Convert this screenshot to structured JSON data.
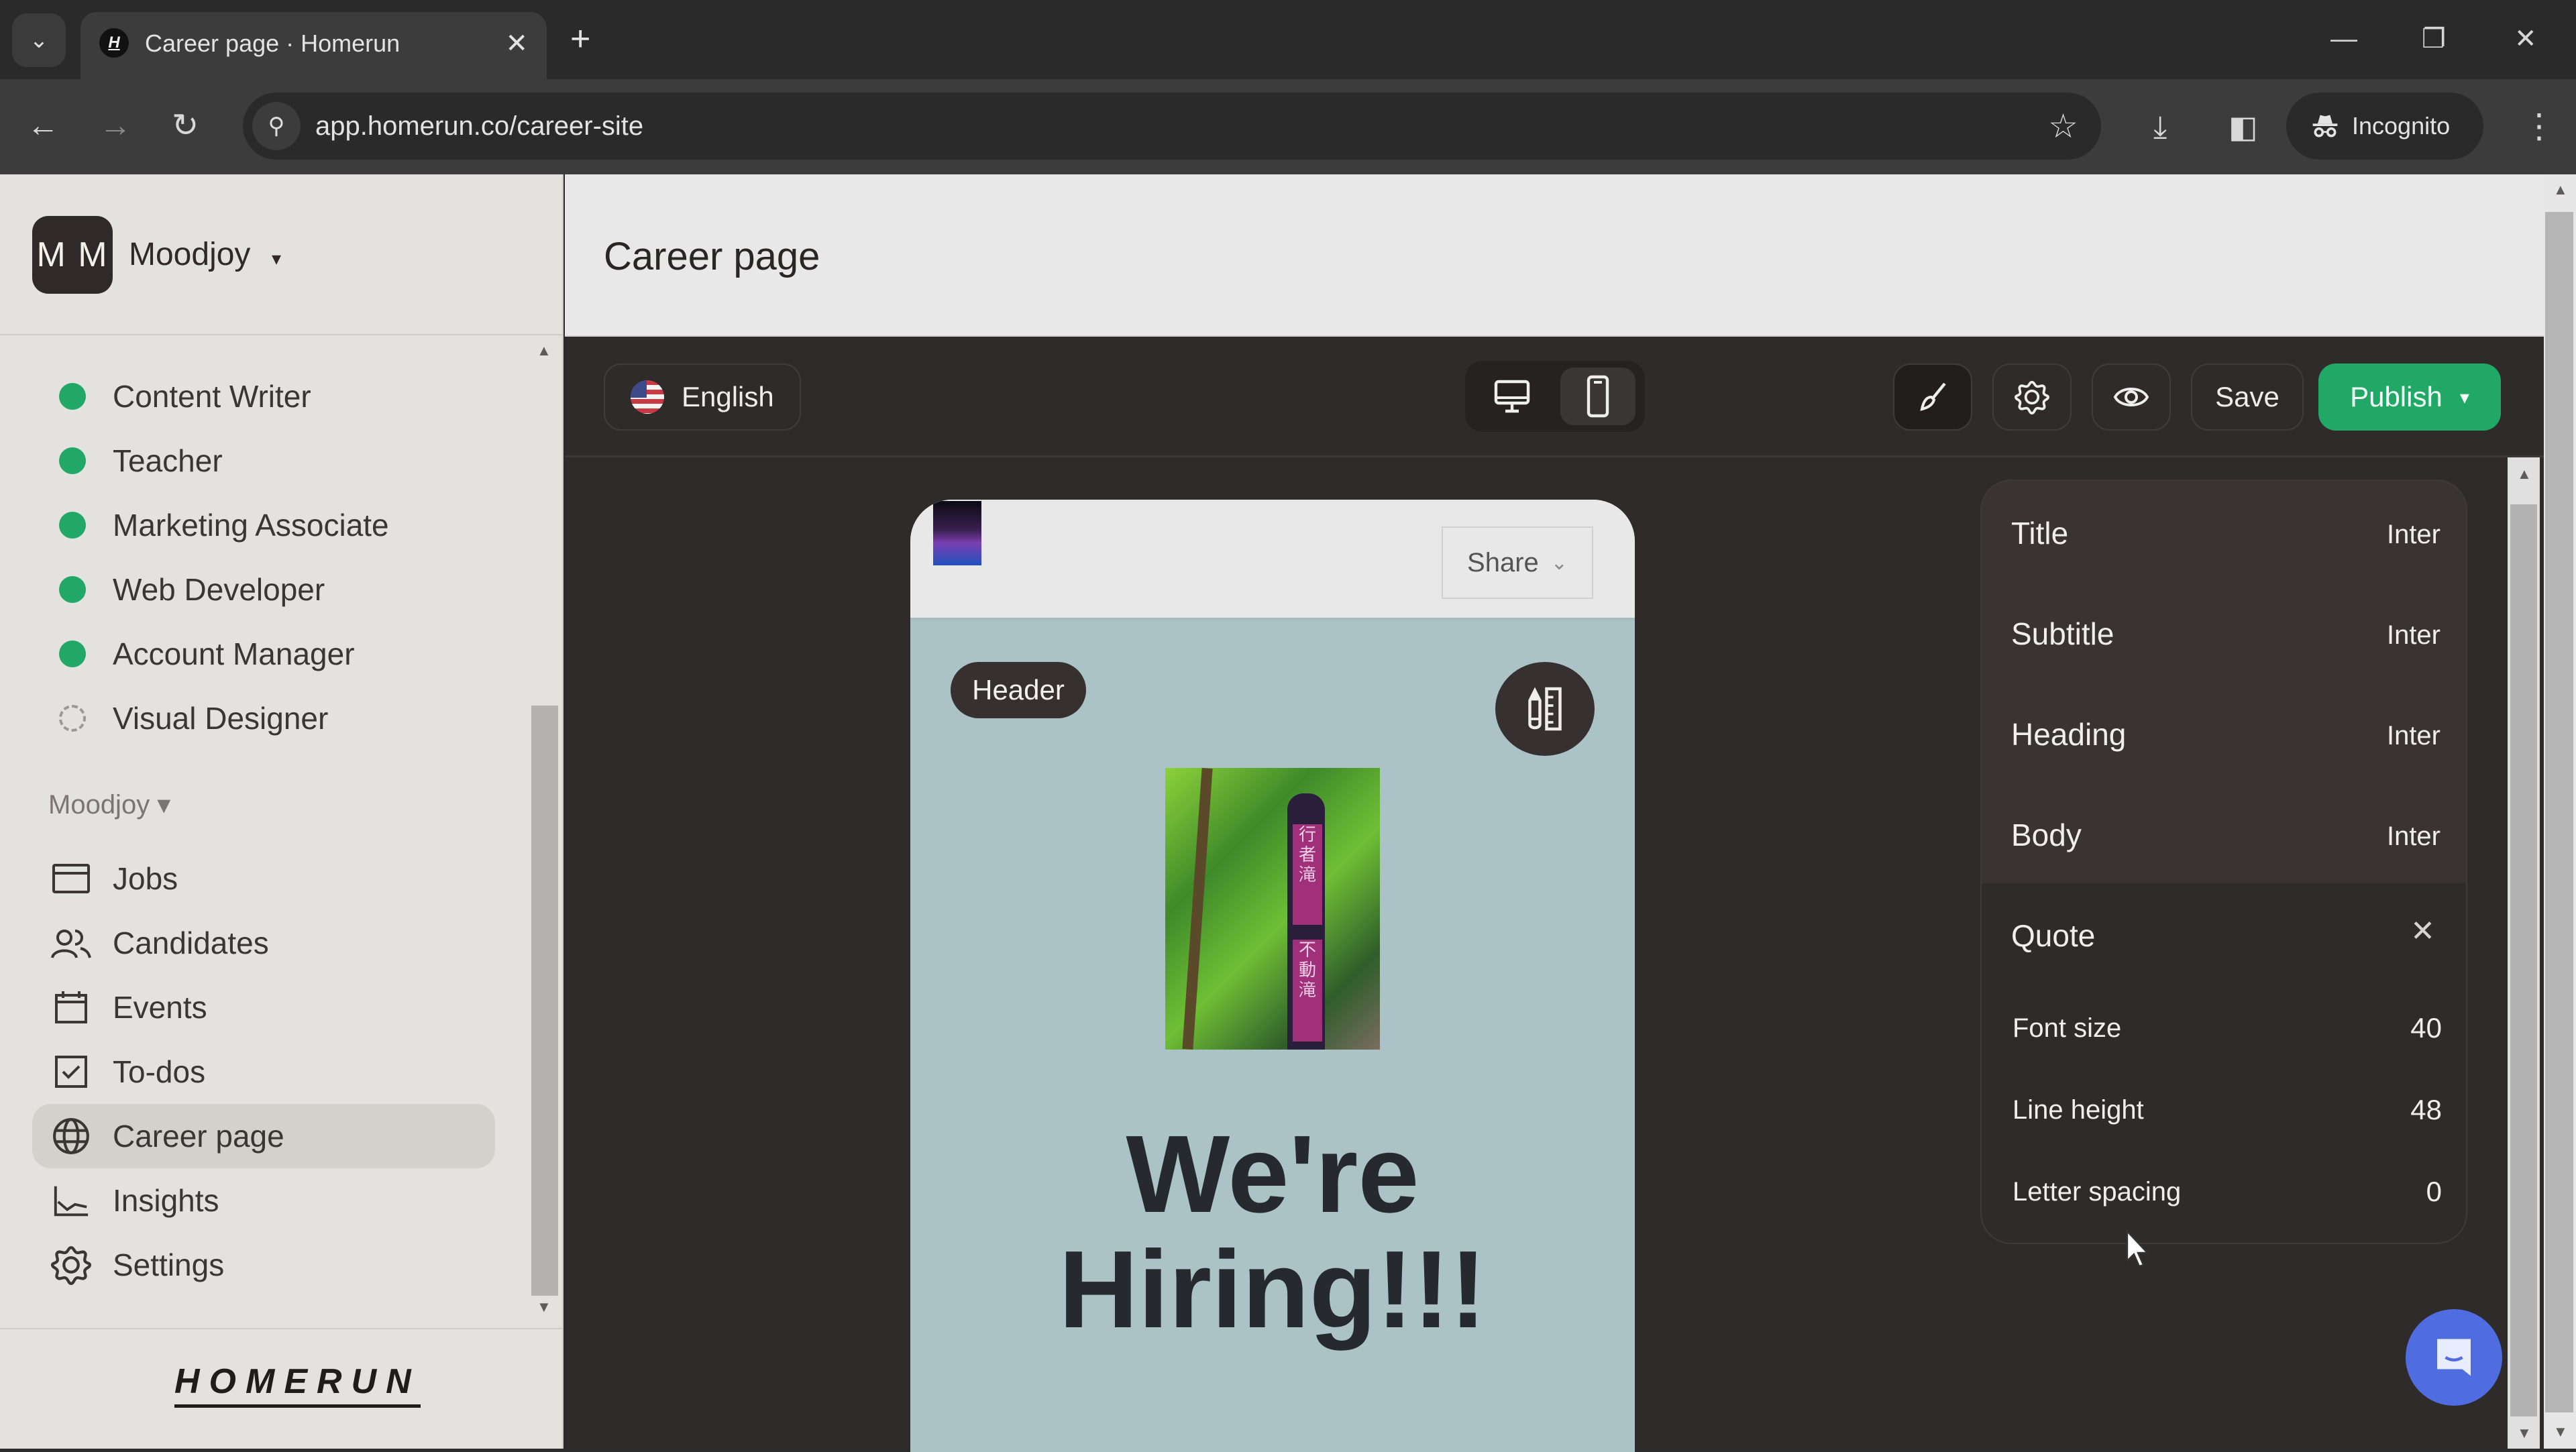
{
  "browser": {
    "tab_title": "Career page · Homerun",
    "tab_favicon": "H",
    "url": "app.homerun.co/career-site",
    "incognito_label": "Incognito",
    "icons": {
      "tab_list": "chevron-down-icon",
      "tab_close": "close-icon",
      "new_tab": "plus-icon",
      "back": "arrow-left-icon",
      "forward": "arrow-right-icon",
      "reload": "reload-icon",
      "site_info": "tune-icon",
      "bookmark": "star-icon",
      "download": "download-icon",
      "side_panel": "side-panel-icon",
      "menu": "kebab-menu-icon"
    },
    "glyphs": {
      "tab_list": "⌄",
      "tab_close": "✕",
      "new_tab": "+",
      "back": "←",
      "forward": "→",
      "reload": "↻",
      "site_info": "⚲",
      "bookmark": "☆",
      "download": "⤓",
      "side_panel": "◧",
      "menu": "⋮",
      "minimize": "—",
      "restore": "❐",
      "close": "✕"
    }
  },
  "sidebar": {
    "avatar_initials": "M M",
    "org_name": "Moodjoy",
    "org_caret": "▾",
    "jobs": [
      {
        "label": "Content Writer",
        "status": "published"
      },
      {
        "label": "Teacher",
        "status": "published"
      },
      {
        "label": "Marketing Associate",
        "status": "published"
      },
      {
        "label": "Web Developer",
        "status": "published"
      },
      {
        "label": "Account Manager",
        "status": "published"
      },
      {
        "label": "Visual Designer",
        "status": "draft"
      }
    ],
    "section_label": "Moodjoy ▾",
    "nav": [
      {
        "label": "Jobs",
        "icon": "jobs-icon",
        "active": false
      },
      {
        "label": "Candidates",
        "icon": "candidates-icon",
        "active": false
      },
      {
        "label": "Events",
        "icon": "calendar-icon",
        "active": false
      },
      {
        "label": "To-dos",
        "icon": "checkbox-icon",
        "active": false
      },
      {
        "label": "Career page",
        "icon": "globe-icon",
        "active": true
      },
      {
        "label": "Insights",
        "icon": "chart-icon",
        "active": false
      },
      {
        "label": "Settings",
        "icon": "gear-icon",
        "active": false
      }
    ],
    "logo_text": "HOMERUN"
  },
  "page": {
    "title": "Career page"
  },
  "editor_toolbar": {
    "language": "English",
    "device_modes": [
      "desktop",
      "mobile"
    ],
    "active_device": "mobile",
    "save_label": "Save",
    "publish_label": "Publish",
    "publish_caret": "▾"
  },
  "preview": {
    "share_label": "Share",
    "share_caret": "⌄",
    "section_tag": "Header",
    "hero_title_line1": "We're",
    "hero_title_line2": "Hiring!!!",
    "hero_subtitle_partial": "... ... ... ... ..."
  },
  "typography_panel": {
    "rows": [
      {
        "label": "Title",
        "font": "Inter"
      },
      {
        "label": "Subtitle",
        "font": "Inter"
      },
      {
        "label": "Heading",
        "font": "Inter"
      },
      {
        "label": "Body",
        "font": "Inter"
      }
    ],
    "quote": {
      "label": "Quote",
      "close_glyph": "✕",
      "settings": [
        {
          "label": "Font size",
          "value": "40"
        },
        {
          "label": "Line height",
          "value": "48"
        },
        {
          "label": "Letter spacing",
          "value": "0"
        }
      ]
    }
  },
  "colors": {
    "accent_green": "#21a866",
    "editor_bg": "#302b2b",
    "sidebar_bg": "#e3e2de",
    "preview_bg": "#abc3c6",
    "chat_blue": "#4f6de0"
  }
}
